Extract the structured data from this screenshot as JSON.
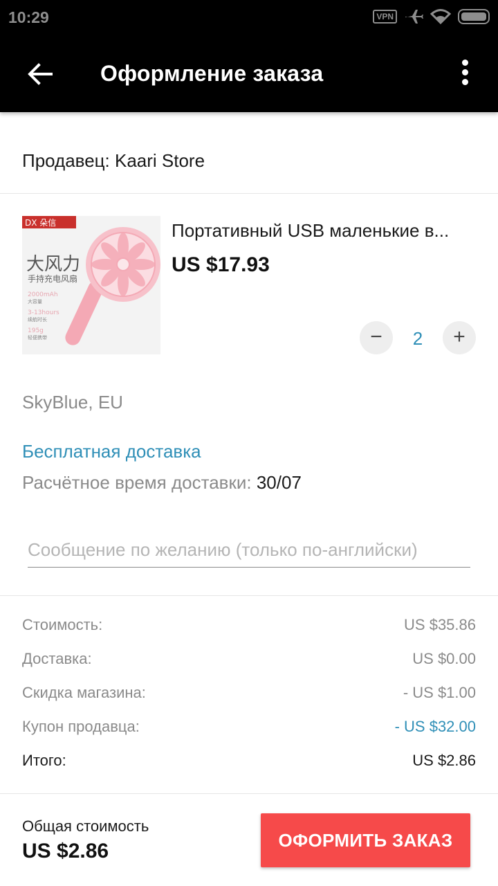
{
  "status_bar": {
    "time": "10:29",
    "vpn": "VPN",
    "icons": [
      "vpn-icon",
      "airplane-icon",
      "wifi-icon",
      "battery-icon"
    ]
  },
  "app_bar": {
    "title": "Оформление заказа",
    "back_icon": "arrow-left-icon",
    "menu_icon": "more-vertical-icon"
  },
  "seller": {
    "label": "Продавец: Kaari Store"
  },
  "product": {
    "name": "Портативный USB маленькие в...",
    "price": "US $17.93",
    "quantity": "2",
    "minus": "−",
    "plus": "+",
    "image_brand": "DX 朵信",
    "image_title": "大风力",
    "image_subtitle": "手持充电风扇",
    "image_spec1": "2000mAh",
    "image_spec1_sub": "大容量",
    "image_spec2": "3-13hours",
    "image_spec2_sub": "续航时长",
    "image_spec3": "195g",
    "image_spec3_sub": "轻便携带"
  },
  "variant": "SkyBlue, EU",
  "shipping": {
    "free": "Бесплатная доставка",
    "estimate_label": "Расчётное время доставки: ",
    "estimate_date": "30/07"
  },
  "message": {
    "placeholder": "Сообщение по желанию (только по-английски)"
  },
  "summary": {
    "cost_label": "Стоимость:",
    "cost_value": "US $35.86",
    "delivery_label": "Доставка:",
    "delivery_value": "US $0.00",
    "store_discount_label": "Скидка магазина:",
    "store_discount_value": "- US $1.00",
    "coupon_label": "Купон продавца:",
    "coupon_value": "- US $32.00",
    "total_label": "Итого:",
    "total_value": "US $2.86"
  },
  "footer": {
    "label": "Общая стоимость",
    "total": "US $2.86",
    "order_button": "ОФОРМИТЬ ЗАКАЗ"
  },
  "colors": {
    "accent_blue": "#2f8fb7",
    "order_red": "#f64a4a",
    "fan_pink": "#f4a9b5"
  }
}
